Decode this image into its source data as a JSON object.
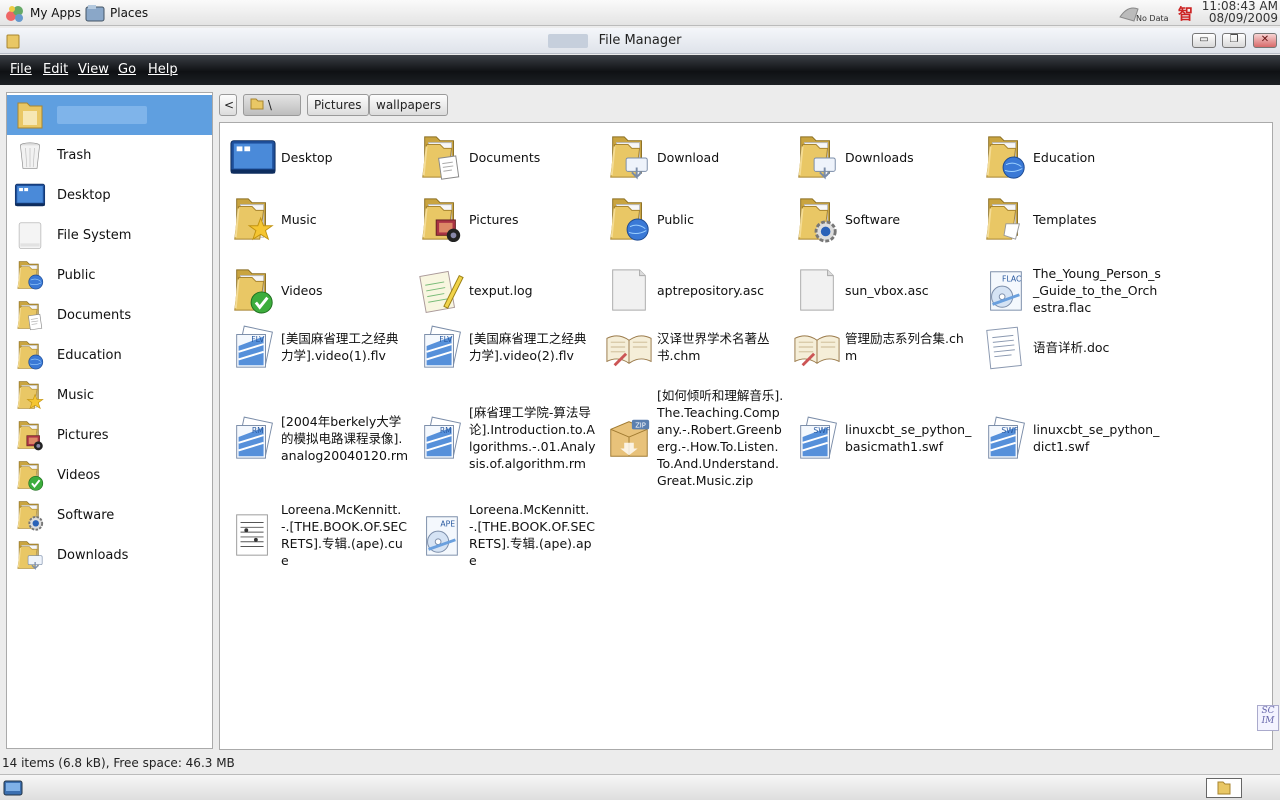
{
  "top_panel": {
    "apps_label": "My Apps",
    "places_label": "Places",
    "network_status": "No Data",
    "input_method_glyph": "智",
    "time": "11:08:43 AM",
    "date": "08/09/2009"
  },
  "window": {
    "title": "File Manager",
    "minimize_glyph": "▭",
    "maximize_glyph": "❐",
    "close_glyph": "✕"
  },
  "menu": {
    "file": "File",
    "edit": "Edit",
    "view": "View",
    "go": "Go",
    "help": "Help"
  },
  "sidebar": {
    "items": [
      {
        "label": "Trash",
        "icon": "trash-icon"
      },
      {
        "label": "Desktop",
        "icon": "desktop-icon"
      },
      {
        "label": "File System",
        "icon": "drive-icon"
      },
      {
        "label": "Public",
        "icon": "folder-globe-icon"
      },
      {
        "label": "Documents",
        "icon": "folder-documents-icon"
      },
      {
        "label": "Education",
        "icon": "folder-globe-icon"
      },
      {
        "label": "Music",
        "icon": "folder-music-icon"
      },
      {
        "label": "Pictures",
        "icon": "folder-pictures-icon"
      },
      {
        "label": "Videos",
        "icon": "folder-videos-icon"
      },
      {
        "label": "Software",
        "icon": "folder-software-icon"
      },
      {
        "label": "Downloads",
        "icon": "folder-downloads-icon"
      }
    ]
  },
  "pathbar": {
    "back_glyph": "<",
    "home_glyph": "\\",
    "crumbs": [
      "Pictures",
      "wallpapers"
    ]
  },
  "files": [
    {
      "name": "Desktop",
      "icon": "desktop-icon"
    },
    {
      "name": "Documents",
      "icon": "folder-documents-icon"
    },
    {
      "name": "Download",
      "icon": "folder-downloads-icon"
    },
    {
      "name": "Downloads",
      "icon": "folder-downloads-icon"
    },
    {
      "name": "Education",
      "icon": "folder-globe-icon"
    },
    {
      "name": "Music",
      "icon": "folder-music-icon"
    },
    {
      "name": "Pictures",
      "icon": "folder-pictures-icon"
    },
    {
      "name": "Public",
      "icon": "folder-globe-icon"
    },
    {
      "name": "Software",
      "icon": "folder-software-icon"
    },
    {
      "name": "Templates",
      "icon": "folder-templates-icon"
    },
    {
      "name": "Videos",
      "icon": "folder-videos-icon"
    },
    {
      "name": "texput.log",
      "icon": "text-log-icon"
    },
    {
      "name": "aptrepository.asc",
      "icon": "blank-file-icon"
    },
    {
      "name": "sun_vbox.asc",
      "icon": "blank-file-icon"
    },
    {
      "name": "The_Young_Person_s_Guide_to_the_Orchestra.flac",
      "icon": "flac-audio-icon",
      "badge": "FLAC"
    },
    {
      "name": "[美国麻省理工之经典力学].video(1).flv",
      "icon": "flv-video-icon",
      "badge": "FLV"
    },
    {
      "name": "[美国麻省理工之经典力学].video(2).flv",
      "icon": "flv-video-icon",
      "badge": "FLV"
    },
    {
      "name": "汉译世界学术名著丛书.chm",
      "icon": "chm-book-icon"
    },
    {
      "name": "管理励志系列合集.chm",
      "icon": "chm-book-icon"
    },
    {
      "name": "语音详析.doc",
      "icon": "doc-file-icon"
    },
    {
      "name": "[2004年berkely大学的模拟电路课程录像].analog20040120.rm",
      "icon": "rm-video-icon",
      "badge": "RM"
    },
    {
      "name": "[麻省理工学院-算法导论].Introduction.to.Algorithms.-.01.Analysis.of.algorithm.rm",
      "icon": "rm-video-icon",
      "badge": "RM"
    },
    {
      "name": "[如何倾听和理解音乐].The.Teaching.Company.-.Robert.Greenberg.-.How.To.Listen.To.And.Understand.Great.Music.zip",
      "icon": "zip-archive-icon",
      "badge": "ZIP"
    },
    {
      "name": "linuxcbt_se_python_basicmath1.swf",
      "icon": "swf-video-icon",
      "badge": "SWF"
    },
    {
      "name": "linuxcbt_se_python_dict1.swf",
      "icon": "swf-video-icon",
      "badge": "SWF"
    },
    {
      "name": "Loreena.McKennitt.-.[THE.BOOK.OF.SECRETS].专辑.(ape).cue",
      "icon": "cue-sheet-icon"
    },
    {
      "name": "Loreena.McKennitt.-.[THE.BOOK.OF.SECRETS].专辑.(ape).ape",
      "icon": "ape-audio-icon",
      "badge": "APE"
    }
  ],
  "status": {
    "text": "14 items (6.8 kB), Free space: 46.3 MB"
  },
  "scim_label": "SC IM",
  "colors": {
    "menubar": "#15181c",
    "sidebar_selected": "#5f9fe0",
    "folder": "#e9c765",
    "folder_dark": "#c9a440"
  }
}
